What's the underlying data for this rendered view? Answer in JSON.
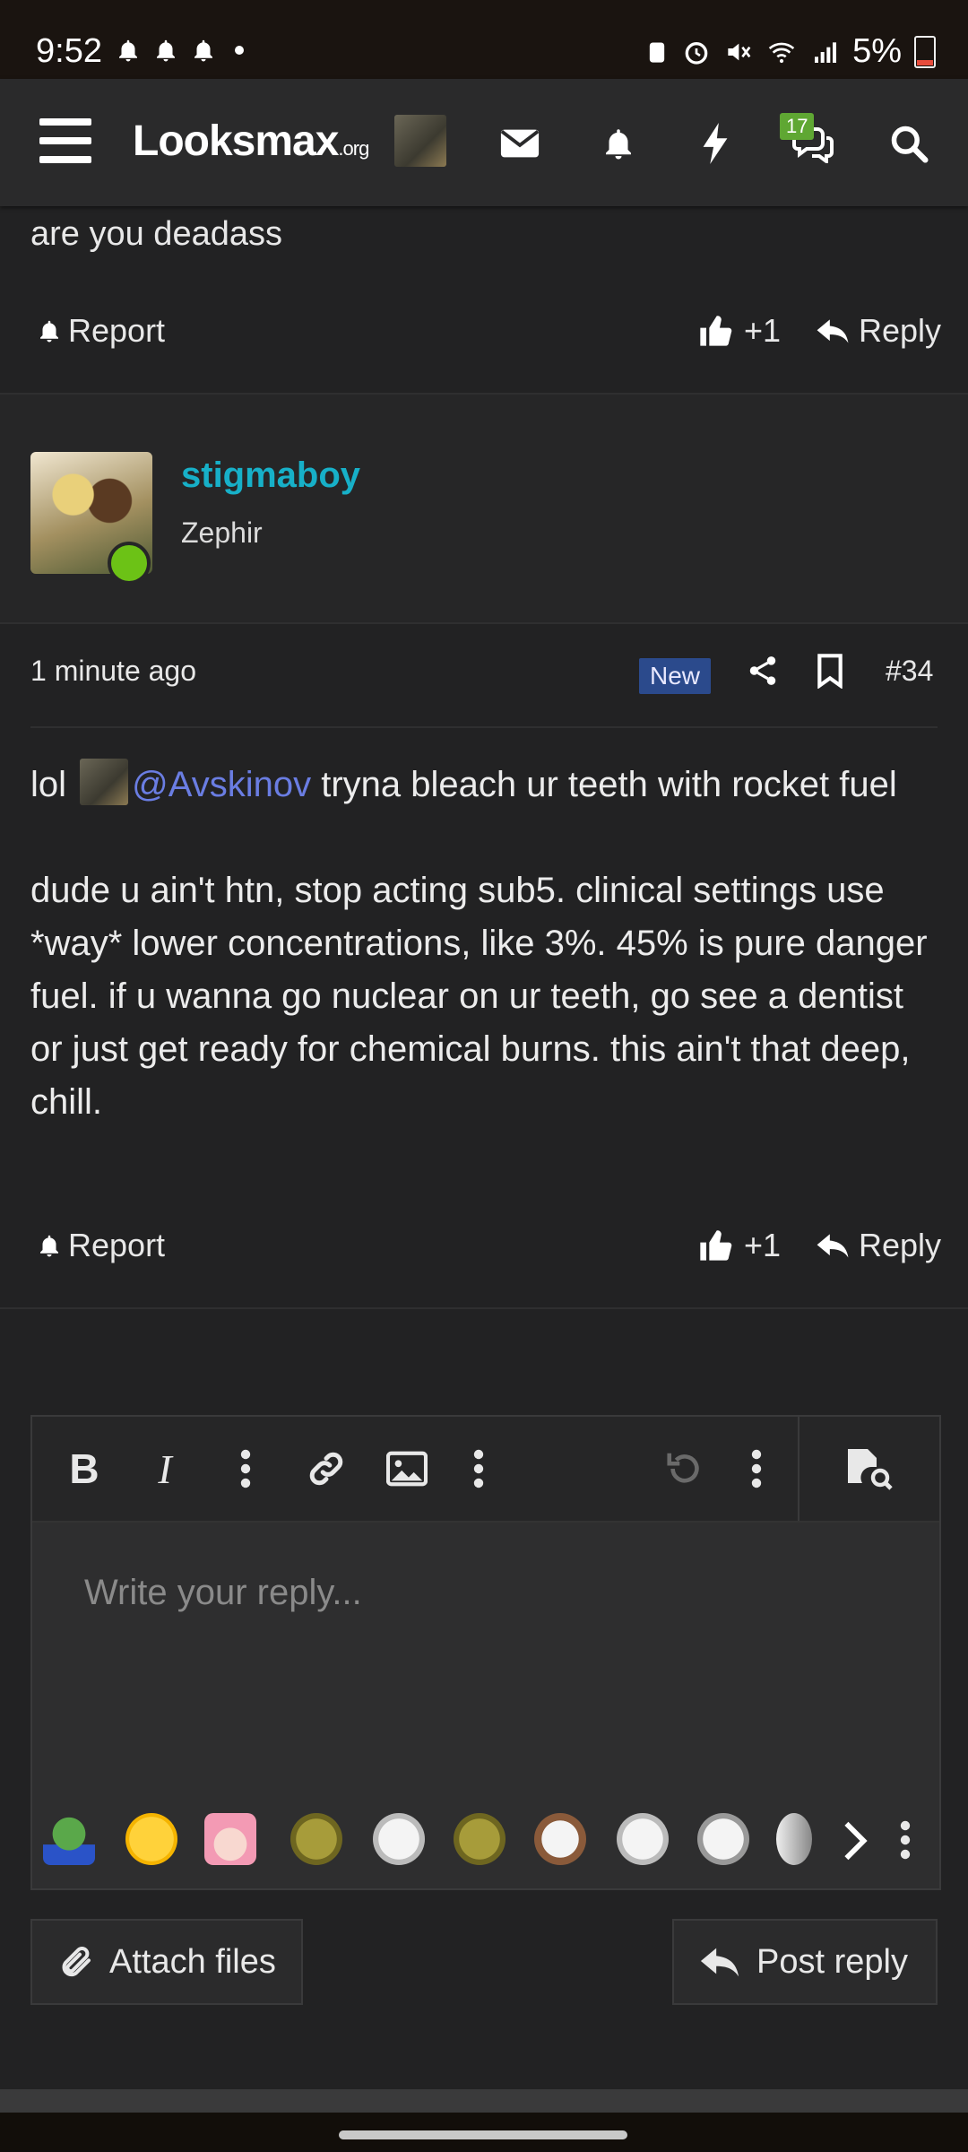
{
  "status_bar": {
    "time": "9:52",
    "battery": "5%"
  },
  "header": {
    "logo_main": "Looksmax",
    "logo_suffix": ".org",
    "chat_badge": "17"
  },
  "prev_post": {
    "text": "are you deadass",
    "report": "Report",
    "like_count": "+1",
    "reply": "Reply"
  },
  "post": {
    "username": "stigmaboy",
    "user_title": "Zephir",
    "time": "1 minute ago",
    "new_badge": "New",
    "number": "#34",
    "line1_prefix": "lol ",
    "mention": "@Avskinov",
    "line1_suffix": " tryna bleach ur teeth with rocket fuel",
    "paragraph2": "dude u ain't htn, stop acting sub5. clinical settings use *way* lower concentrations, like 3%. 45% is pure danger fuel. if u wanna go nuclear on ur teeth, go see a dentist or just get ready for chemical burns. this ain't that deep, chill.",
    "report": "Report",
    "like_count": "+1",
    "reply": "Reply"
  },
  "editor": {
    "placeholder": "Write your reply...",
    "toolbar_icons": [
      "bold-icon",
      "italic-icon",
      "more-icon",
      "link-icon",
      "image-icon",
      "more-icon",
      "undo-icon",
      "more-icon",
      "preview-icon"
    ]
  },
  "buttons": {
    "attach": "Attach files",
    "post_reply": "Post reply"
  },
  "colors": {
    "accent_username": "#17b0c8",
    "mention": "#6a7de2",
    "new_badge": "#2b4a8c",
    "online": "#6cc216",
    "chat_badge": "#5fa733"
  }
}
